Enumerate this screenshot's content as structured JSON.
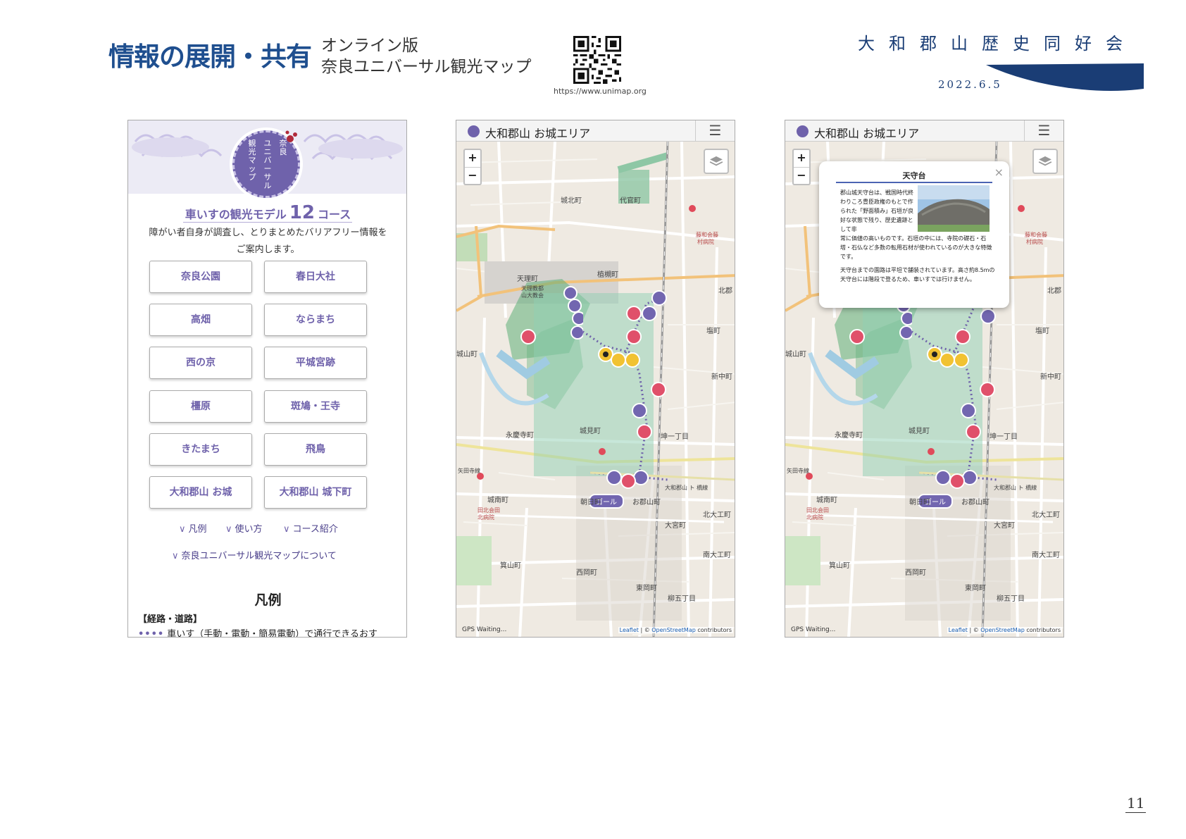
{
  "header": {
    "title": "情報の展開・共有",
    "subtitle_line1": "オンライン版",
    "subtitle_line2": "奈良ユニバーサル観光マップ",
    "qr_url": "https://www.unimap.org",
    "organization": "大和郡山歴史同好会",
    "date": "2022.6.5"
  },
  "page_number": "11",
  "screen1": {
    "badge_cols": [
      "奈良",
      "ユニバーサル",
      "観光マップ"
    ],
    "heading_prefix": "車いすの観光モデル",
    "heading_number": "12",
    "heading_suffix": "コース",
    "description_line1": "障がい者自身が調査し、とりまとめたバリアフリー情報を",
    "description_line2": "ご案内します。",
    "courses": [
      "奈良公園",
      "春日大社",
      "高畑",
      "ならまち",
      "西の京",
      "平城宮跡",
      "橿原",
      "斑鳩・王寺",
      "きたまち",
      "飛鳥",
      "大和郡山 お城",
      "大和郡山 城下町"
    ],
    "links": [
      "凡例",
      "使い方",
      "コース紹介"
    ],
    "about_link": "奈良ユニバーサル観光マップについて",
    "legend_title": "凡例",
    "legend_section": "【経路・道路】",
    "legend_item": "車いす（手動・電動・簡易電動）で通行できるおす"
  },
  "map": {
    "title": "大和郡山 お城エリア",
    "zoom_in": "+",
    "zoom_out": "−",
    "gps_status": "GPS Waiting...",
    "attribution_leaflet": "Leaflet",
    "attribution_sep": " | © ",
    "attribution_osm": "OpenStreetMap",
    "attribution_suffix": " contributors",
    "labels": {
      "jokita": "城北町",
      "daikan": "代官町",
      "tenri": "天理町",
      "tenri_church": "天理教都",
      "tenri_church2": "山大教会",
      "hosomi": "植槻町",
      "kitagun": "北郡",
      "shio": "塩町",
      "shinchu": "新中町",
      "eikeiji": "永慶寺町",
      "joken": "城見町",
      "nichome": "坤一丁目",
      "yatagi": "矢田寺線",
      "jonan": "城南町",
      "asahi": "朝日町",
      "ojoshita": "お郡山町",
      "omiya": "大宮町",
      "kitadaiku": "北大工町",
      "minamidaiku": "南大工町",
      "minowa": "箕山町",
      "nishioka": "西岡町",
      "higashioka": "東岡町",
      "yanagi5": "柳五丁目",
      "goal": "ゴール",
      "hospital": "田北会田",
      "hospital2": "北病院",
      "goto": "藤和会藤",
      "goto2": "村病院",
      "rail": "大和郡山 ト 橋線",
      "shiroyama": "城山町"
    }
  },
  "popup": {
    "title": "天守台",
    "close": "×",
    "body1": "郡山城天守台は、戦国時代終わりころ豊臣政権のもとで作られた「野面積み」石垣が良好な状態で残り、歴史遺跡として非",
    "body1b": "常に価値の高いものです。石垣の中には、寺院の礎石・石塔・石仏など多数の転用石材が使われているのが大きな特徴です。",
    "body2": "天守台までの園路は平坦で舗装されています。高さ約8.5mの天守台には階段で登るため、車いすでは行けません。"
  },
  "colors": {
    "title_blue": "#1f4f8f",
    "accent_purple": "#6f62ab",
    "route_green": "#7fc8a9",
    "road_orange": "#f2c27a"
  }
}
